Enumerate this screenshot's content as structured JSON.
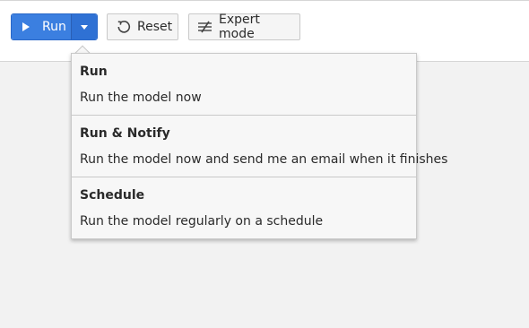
{
  "toolbar": {
    "run_label": "Run",
    "reset_label": "Reset",
    "expert_label": "Expert mode"
  },
  "run_menu": {
    "items": [
      {
        "title": "Run",
        "description": "Run the model now"
      },
      {
        "title": "Run & Notify",
        "description": "Run the model now and send me an email when it finishes"
      },
      {
        "title": "Schedule",
        "description": "Run the model regularly on a schedule"
      }
    ]
  },
  "icons": {
    "run": "play-icon",
    "dropdown": "caret-down-icon",
    "reset": "reset-icon",
    "expert": "sliders-icon"
  },
  "colors": {
    "primary": "#3b7fe0",
    "primary_dark": "#2f71d4",
    "background": "#f2f2f2"
  }
}
